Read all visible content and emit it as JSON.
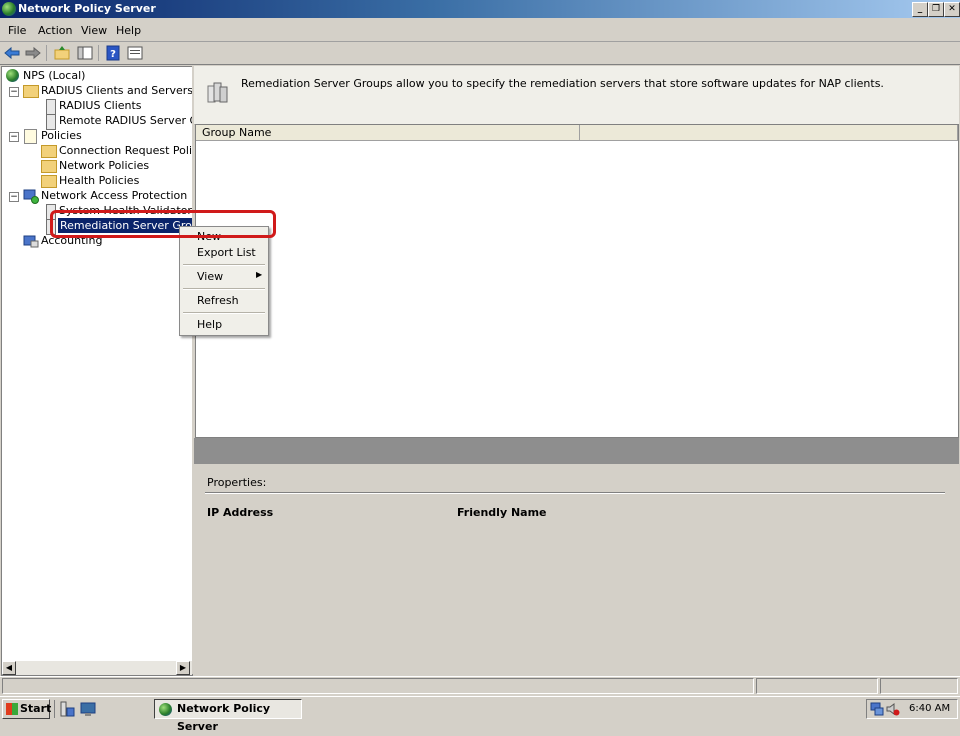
{
  "window": {
    "title": "Network Policy Server",
    "app_icon": "nps-globe-icon"
  },
  "menu": [
    "File",
    "Action",
    "View",
    "Help"
  ],
  "toolbar": {
    "buttons": [
      "back-arrow-icon",
      "forward-arrow-icon",
      "up-folder-icon",
      "show-hide-tree-icon",
      "help-icon",
      "properties-icon"
    ]
  },
  "tree": {
    "root": "NPS (Local)",
    "radius": {
      "label": "RADIUS Clients and Servers",
      "children": [
        "RADIUS Clients",
        "Remote RADIUS Server Grou"
      ]
    },
    "policies": {
      "label": "Policies",
      "children": [
        "Connection Request Policies",
        "Network Policies",
        "Health Policies"
      ]
    },
    "nap": {
      "label": "Network Access Protection",
      "children": [
        "System Health Validators",
        "Remediation Server Groups"
      ]
    },
    "accounting": "Accounting"
  },
  "description": "Remediation Server Groups allow you to specify the remediation servers that store software updates for NAP clients.",
  "list": {
    "columns": [
      "Group Name",
      ""
    ]
  },
  "properties": {
    "label": "Properties:",
    "columns": [
      "IP Address",
      "Friendly Name"
    ]
  },
  "context_menu": {
    "items": [
      "New",
      "Export List",
      "View",
      "Refresh",
      "Help"
    ]
  },
  "taskbar": {
    "start": "Start",
    "task": "Network Policy Server",
    "clock": "6:40 AM"
  },
  "colors": {
    "selection": "#0a246a",
    "annotation": "#d01a1a",
    "titlebar": "#0a246a"
  }
}
